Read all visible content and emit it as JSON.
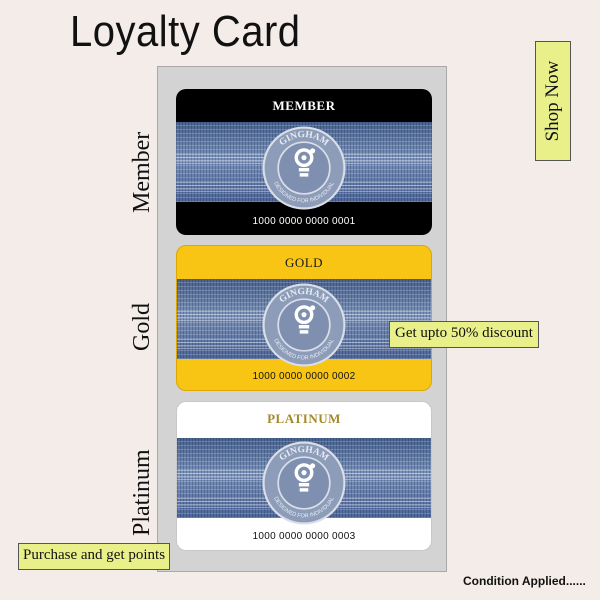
{
  "title": "Loyalty Card",
  "shop_button": "Shop Now",
  "discount_tag": "Get upto 50% discount",
  "points_tag": "Purchase and get points",
  "condition": "Condition Applied......",
  "seal": {
    "brand": "GINGHAM",
    "tagline": "DESIGNED FOR INDIVIDUAL"
  },
  "colors": {
    "member": "#000000",
    "gold": "#f8c515",
    "platinum": "#ffffff",
    "accent": "#e9f08a"
  },
  "cards": [
    {
      "side_label": "Member",
      "tier": "MEMBER",
      "number": "1000 0000 0000 0001"
    },
    {
      "side_label": "Gold",
      "tier": "GOLD",
      "number": "1000 0000 0000 0002"
    },
    {
      "side_label": "Platinum",
      "tier": "PLATINUM",
      "number": "1000 0000 0000 0003"
    }
  ]
}
